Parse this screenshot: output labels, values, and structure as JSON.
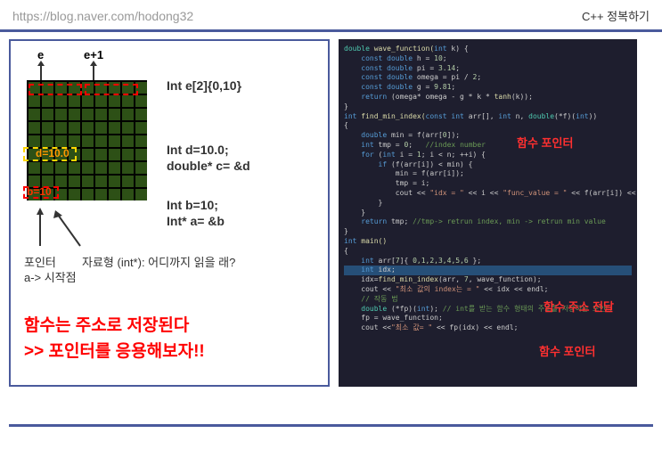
{
  "header": {
    "url": "https://blog.naver.com/hodong32",
    "title": "C++ 정복하기"
  },
  "left": {
    "e_label": "e",
    "e1_label": "e+1",
    "decl_e": "Int e[2]{0,10}",
    "decl_d1": "Int d=10.0;",
    "decl_d2": "double* c= &d",
    "decl_b1": "Int b=10;",
    "decl_b2": "Int* a= &b",
    "cell_d": "d=10.0",
    "cell_b": "b=10",
    "pointer_label": "포인터",
    "a_start": "a-> 시작점",
    "type_label": "자료형 (int*): 어디까지 읽을 래?",
    "big1": "함수는 주소로 저장된다",
    "big2": ">> 포인터를 응용해보자!!"
  },
  "anno": {
    "fp1": "함수 포인터",
    "addr": "함수 주소 전달",
    "fp2": "함수 포인터"
  },
  "code": {
    "l1a": "double",
    "l1b": " wave_function(",
    "l1c": "int",
    "l1d": " k) {",
    "l2a": "    const double",
    "l2b": " h = ",
    "l2c": "10",
    "l2d": ";",
    "l3a": "    const double",
    "l3b": " pi = ",
    "l3c": "3.14",
    "l3d": ";",
    "l4a": "    const double",
    "l4b": " omega = pi / ",
    "l4c": "2",
    "l4d": ";",
    "l5a": "    const double",
    "l5b": " g = ",
    "l5c": "9.81",
    "l5d": ";",
    "l6a": "    return",
    "l6b": " (omega* omega - g * k * ",
    "l6c": "tanh",
    "l6d": "(k));",
    "l7": "}",
    "l8a": "int",
    "l8b": " find_min_index(",
    "l8c": "const int",
    "l8d": " arr[], ",
    "l8e": "int",
    "l8f": " n, ",
    "l8g": "double",
    "l8h": "(*f)(",
    "l8i": "int",
    "l8j": "))",
    "l9": "{",
    "l10a": "    double",
    "l10b": " min = f(arr[",
    "l10c": "0",
    "l10d": "]);",
    "l11a": "    int",
    "l11b": " tmp = ",
    "l11c": "0",
    "l11d": ";   ",
    "l11e": "//index number",
    "l12a": "    for",
    "l12b": " (",
    "l12c": "int",
    "l12d": " i = ",
    "l12e": "1",
    "l12f": "; i < n; ++i) {",
    "l13a": "        if",
    "l13b": " (f(arr[i]) < min) {",
    "l14": "            min = f(arr[i]);",
    "l15": "            tmp = i;",
    "l16a": "            cout << ",
    "l16b": "\"idx = \"",
    "l16c": " << i << ",
    "l16d": "\"func_value = \"",
    "l16e": " << f(arr[i]) << std::endl;",
    "l17": "        }",
    "l18": "    }",
    "l19a": "    return",
    "l19b": " tmp; ",
    "l19c": "//tmp-> retrun index, min -> retrun min value",
    "l20": "}",
    "l21a": "int",
    "l21b": " main()",
    "l22": "{",
    "l23a": "    int",
    "l23b": " arr[",
    "l23c": "7",
    "l23d": "]{ ",
    "l23e": "0,1,2,3,4,5,6",
    "l23f": " };",
    "l24a": "    int",
    "l24b": " idx;",
    "l25a": "    idx=",
    "l25b": "find_min_index",
    "l25c": "(arr, ",
    "l25d": "7",
    "l25e": ", wave_function);",
    "l26a": "    cout << ",
    "l26b": "\"최소 값의 index는 = \"",
    "l26c": " << idx << endl;",
    "l27": "    // 작동 법",
    "l28a": "    double",
    "l28b": " (*fp)(",
    "l28c": "int",
    "l28d": "); ",
    "l28e": "// int를 받는 함수 형태의 주소를 저장하는 포인터",
    "l29": "    fp = wave_function;",
    "l30a": "    cout <<",
    "l30b": "\"최소 값= \"",
    "l30c": " << fp(idx) << endl;"
  }
}
